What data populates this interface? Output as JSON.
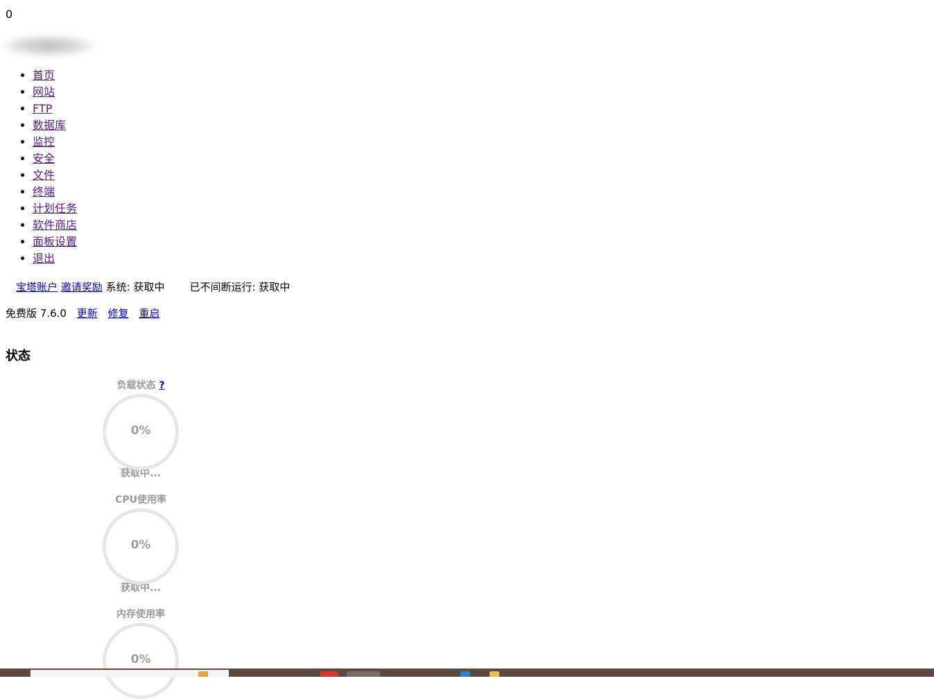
{
  "counter": "0",
  "nav": {
    "items": [
      {
        "label": "首页"
      },
      {
        "label": "网站"
      },
      {
        "label": "FTP"
      },
      {
        "label": "数据库"
      },
      {
        "label": "监控"
      },
      {
        "label": "安全"
      },
      {
        "label": "文件"
      },
      {
        "label": "终端"
      },
      {
        "label": "计划任务"
      },
      {
        "label": "软件商店"
      },
      {
        "label": "面板设置"
      },
      {
        "label": "退出"
      }
    ]
  },
  "header": {
    "account_link": "宝塔账户",
    "invite_link": "邀请奖励",
    "system_label": "系统:",
    "system_value": "获取中",
    "uptime_label": "已不间断运行:",
    "uptime_value": "获取中"
  },
  "version": {
    "text": "免费版 7.6.0",
    "update": "更新",
    "repair": "修复",
    "restart": "重启"
  },
  "status": {
    "title": "状态",
    "gauges": [
      {
        "title": "负载状态",
        "help": "?",
        "value": "0%",
        "sub": "获取中..."
      },
      {
        "title": "CPU使用率",
        "value": "0%",
        "sub": "获取中..."
      },
      {
        "title": "内存使用率",
        "value": "0%"
      }
    ]
  },
  "colors": {
    "link": "#0000ee",
    "visited_link": "#551a8b",
    "gauge_ring": "#e6e6e6",
    "gauge_text": "#999999",
    "taskbar": "#5a4a40"
  }
}
